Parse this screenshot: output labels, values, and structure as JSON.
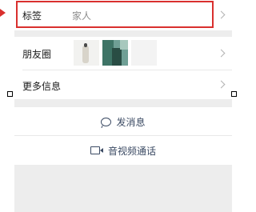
{
  "profile_rows": {
    "tags": {
      "label": "标签",
      "value": "家人"
    },
    "moments": {
      "label": "朋友圈"
    },
    "more_info": {
      "label": "更多信息"
    }
  },
  "actions": {
    "send_message": {
      "label": "发消息",
      "icon": "message-bubble-icon"
    },
    "video_call": {
      "label": "音视频通话",
      "icon": "video-camera-icon"
    }
  },
  "colors": {
    "highlight": "#d9302e",
    "action_text": "#3b4a63",
    "page_bg": "#ededed"
  }
}
